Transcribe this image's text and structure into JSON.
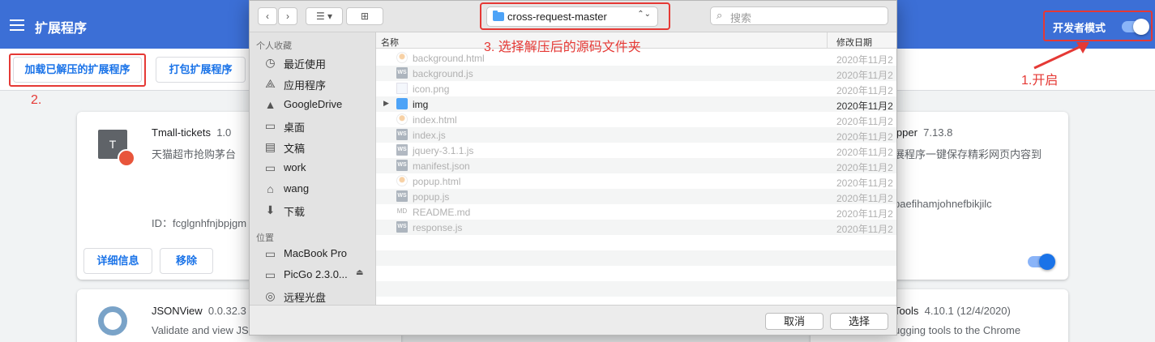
{
  "header": {
    "title": "扩展程序",
    "dev_mode_label": "开发者模式"
  },
  "toolbar": {
    "load_unpacked": "加载已解压的扩展程序",
    "pack": "打包扩展程序"
  },
  "annotations": {
    "step1": "1.开启",
    "step2": "2.",
    "step3": "3. 选择解压后的源码文件夹"
  },
  "cards": {
    "tmall": {
      "icon_letter": "T",
      "name": "Tmall-tickets",
      "version": "1.0",
      "desc": "天猫超市抢购茅台",
      "id": "ID：fcglgnhfnjbpjgm",
      "details": "详细信息",
      "remove": "移除"
    },
    "clipper": {
      "name": "ipper",
      "version": "7.13.8",
      "desc": "展程序一键保存精彩网页内容到",
      "id": "baefihamjohnefbikjilc"
    },
    "jsonview": {
      "name": "JSONView",
      "version": "0.0.32.3",
      "desc": "Validate and view JS"
    },
    "tools": {
      "name": "Tools",
      "version": "4.10.1 (12/4/2020)",
      "desc": "ugging tools to the Chrome"
    }
  },
  "dialog": {
    "path": "cross-request-master",
    "search_placeholder": "搜索",
    "favorites_section": "个人收藏",
    "favorites": [
      {
        "label": "最近使用",
        "icon": "clock-icon"
      },
      {
        "label": "应用程序",
        "icon": "apps-icon"
      },
      {
        "label": "GoogleDrive",
        "icon": "drive-icon"
      },
      {
        "label": "桌面",
        "icon": "desktop-icon"
      },
      {
        "label": "文稿",
        "icon": "document-icon"
      },
      {
        "label": "work",
        "icon": "folder-icon"
      },
      {
        "label": "wang",
        "icon": "home-icon"
      },
      {
        "label": "下载",
        "icon": "download-icon"
      }
    ],
    "locations_section": "位置",
    "locations": [
      {
        "label": "MacBook Pro",
        "icon": "laptop-icon"
      },
      {
        "label": "PicGo 2.3.0...",
        "icon": "disk-icon"
      },
      {
        "label": "远程光盘",
        "icon": "disc-icon"
      }
    ],
    "columns": {
      "name": "名称",
      "date": "修改日期"
    },
    "files": [
      {
        "name": "background.html",
        "date": "2020年11月2",
        "icon": "html-icon",
        "enabled": false
      },
      {
        "name": "background.js",
        "date": "2020年11月2",
        "icon": "ws-js-icon",
        "enabled": false
      },
      {
        "name": "icon.png",
        "date": "2020年11月2",
        "icon": "png-icon",
        "enabled": false
      },
      {
        "name": "img",
        "date": "2020年11月2",
        "icon": "folder-icon",
        "enabled": true
      },
      {
        "name": "index.html",
        "date": "2020年11月2",
        "icon": "html-icon",
        "enabled": false
      },
      {
        "name": "index.js",
        "date": "2020年11月2",
        "icon": "ws-js-icon",
        "enabled": false
      },
      {
        "name": "jquery-3.1.1.js",
        "date": "2020年11月2",
        "icon": "ws-js-icon",
        "enabled": false
      },
      {
        "name": "manifest.json",
        "date": "2020年11月2",
        "icon": "ws-json-icon",
        "enabled": false
      },
      {
        "name": "popup.html",
        "date": "2020年11月2",
        "icon": "html-icon",
        "enabled": false
      },
      {
        "name": "popup.js",
        "date": "2020年11月2",
        "icon": "ws-js-icon",
        "enabled": false
      },
      {
        "name": "README.md",
        "date": "2020年11月2",
        "icon": "md-icon",
        "enabled": false
      },
      {
        "name": "response.js",
        "date": "2020年11月2",
        "icon": "ws-js-icon",
        "enabled": false
      }
    ],
    "cancel": "取消",
    "choose": "选择"
  },
  "colors": {
    "header_blue": "#3c6fd6",
    "annotation_red": "#e53935",
    "link_blue": "#1a73e8"
  }
}
